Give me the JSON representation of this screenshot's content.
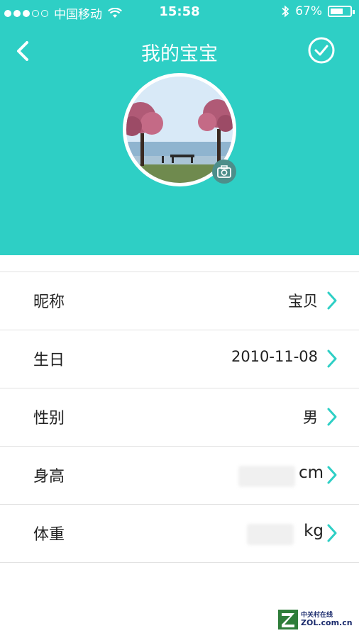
{
  "status_bar": {
    "carrier": "中国移动",
    "time": "15:58",
    "battery_percent": "67%",
    "battery_level": 0.67,
    "signal_bars_filled": 3,
    "signal_bars_total": 5
  },
  "nav": {
    "title": "我的宝宝",
    "back_icon": "chevron-left-icon",
    "confirm_icon": "check-circle-icon"
  },
  "profile": {
    "avatar_alt": "baby-avatar",
    "camera_icon": "camera-icon"
  },
  "fields": [
    {
      "label": "昵称",
      "value": "宝贝"
    },
    {
      "label": "生日",
      "value": "2010-11-08"
    },
    {
      "label": "性别",
      "value": "男"
    },
    {
      "label": "身高",
      "value": "",
      "unit": "cm"
    },
    {
      "label": "体重",
      "value": "",
      "unit": "kg"
    }
  ],
  "watermark": {
    "cn": "中关村在线",
    "en": "ZOL.com.cn"
  },
  "colors": {
    "accent": "#2ecfc5",
    "chevron": "#2ecfc5",
    "text": "#222222",
    "divider": "#e2e2e2"
  }
}
